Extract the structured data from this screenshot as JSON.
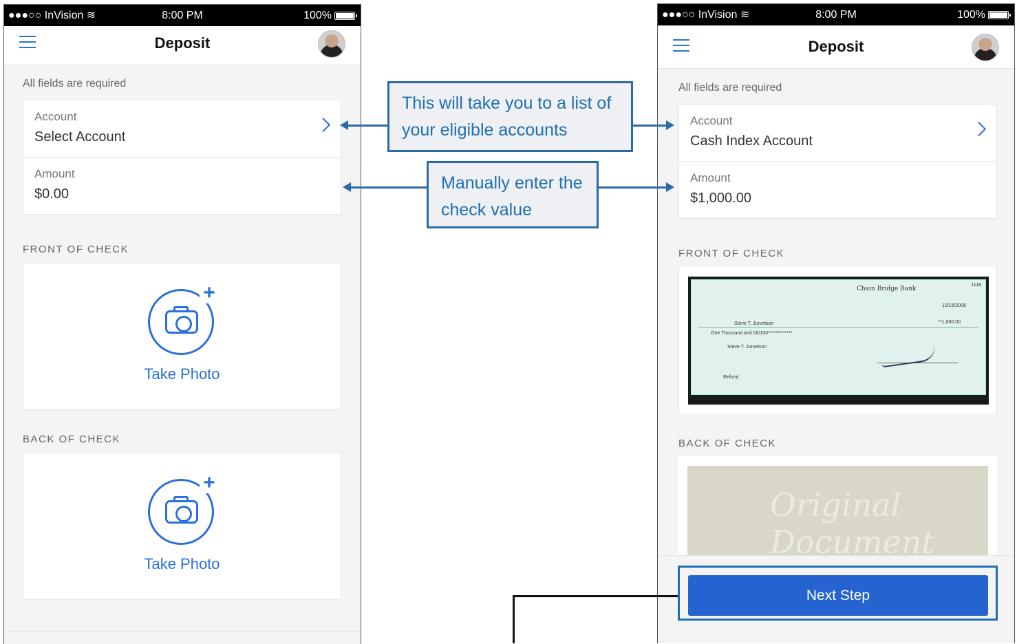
{
  "status_bar": {
    "carrier": "●●●○○ InVision ︎≋",
    "time": "8:00 PM",
    "battery": "100%"
  },
  "left_screen": {
    "title": "Deposit",
    "required_note": "All fields are required",
    "account_label": "Account",
    "account_value": "Select Account",
    "amount_label": "Amount",
    "amount_value": "$0.00",
    "front_label": "FRONT OF CHECK",
    "back_label": "BACK OF CHECK",
    "take_photo_front": "Take Photo",
    "take_photo_back": "Take Photo"
  },
  "right_screen": {
    "title": "Deposit",
    "required_note": "All fields are required",
    "account_label": "Account",
    "account_value": "Cash Index Account",
    "amount_label": "Amount",
    "amount_value": "$1,000.00",
    "front_label": "FRONT OF CHECK",
    "back_label": "BACK OF CHECK",
    "next_button": "Next Step",
    "check_front": {
      "bank": "Chain Bridge Bank",
      "number": "1118",
      "date": "10/15/2006",
      "payee": "Steve T. Jurvetson",
      "amount": "**1,000.00",
      "written": "One Thousand and 00/100*************",
      "memo": "Refund"
    },
    "check_back_watermark": "Original Document"
  },
  "callouts": {
    "account": "This will take you to a list of your eligible accounts",
    "amount": "Manually enter the check value"
  },
  "colors": {
    "accent": "#2a6fdb",
    "callout_border": "#2b6aa8",
    "button": "#2563d0"
  }
}
